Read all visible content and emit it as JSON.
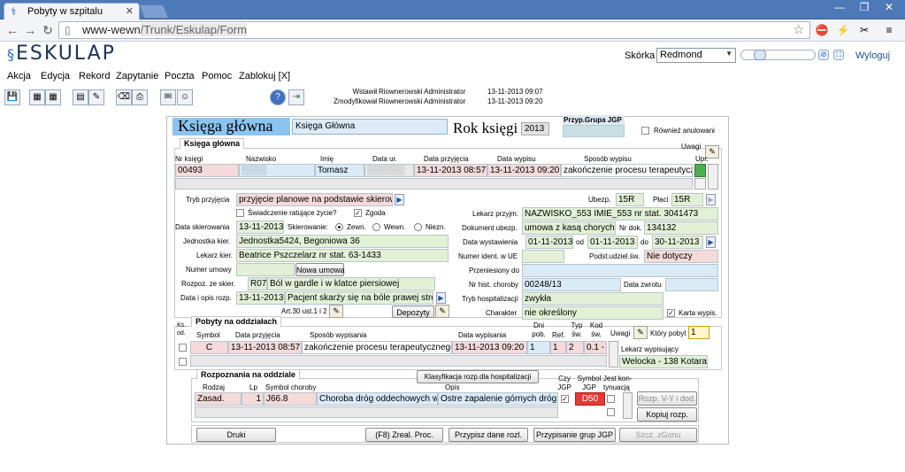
{
  "browser": {
    "tab_title": "Pobyty w szpitalu",
    "url_host": "www-wewn",
    "url_path": "/Trunk/Eskulap/Form",
    "icons": [
      "page-icon",
      "star-icon",
      "stop-icon",
      "bolt-icon",
      "plugin-icon",
      "menu-icon"
    ]
  },
  "app": {
    "logo": "ESKULAP",
    "skin_label": "Skórka",
    "skin_value": "Redmond",
    "logout": "Wyloguj"
  },
  "menu": [
    "Akcja",
    "Edycja",
    "Rekord",
    "Zapytanie",
    "Poczta",
    "Pomoc",
    "Zablokuj [X]"
  ],
  "audit": {
    "created_label": "Wstawił",
    "created_user": "Riownerowski Administrator",
    "created_time": "13-11-2013 09:07",
    "modified_label": "Zmodyfikował",
    "modified_user": "Riownerowski Administrator",
    "modified_time": "13-11-2013 09:20"
  },
  "form": {
    "title": "Księga główna",
    "book_name": "Księga Główna",
    "year_label": "Rok księgi",
    "year": "2013",
    "group_label": "Przyp.Grupa JGP",
    "also_cancelled": "Również anulowani",
    "section_main": "Księga główna",
    "cols": {
      "nr": "Nr księgi",
      "surname": "Nazwisko",
      "name": "Imię",
      "birth": "Data ur.",
      "admit": "Data przyjęcia",
      "discharge": "Data wypisu",
      "mode": "Sposób wypisu",
      "notes": "Uwagi",
      "upr": "Upr."
    },
    "row": {
      "nr": "00493",
      "name": "Tomasz",
      "admit": "13-11-2013 08:57",
      "discharge": "13-11-2013 09:20",
      "mode": "zakończenie procesu terapeutycz"
    },
    "admission_mode_label": "Tryb przyjęcia",
    "admission_mode": "przyjęcie planowe na podstawie skierow:",
    "ubezp_label": "Ubezp.",
    "ubezp": "15R",
    "payer_label": "Płaci",
    "payer": "15R",
    "rescue_label": "Świadczenie ratujące życie?",
    "consent_label": "Zgoda",
    "ref_date_label": "Data skierowania",
    "ref_date": "13-11-2013",
    "ref_label": "Skierowanie:",
    "ref_ext": "Zewn.",
    "ref_int": "Wewn.",
    "ref_unk": "Niezn.",
    "unit_label": "Jednostka kier.",
    "unit": "Jednostka5424, Begoniowa 36",
    "doctor_ref_label": "Lekarz kier.",
    "doctor_ref": "Beatrice Pszczelarz nr stat. 63-1433",
    "contract_label": "Numer umowy",
    "new_contract": "Nowa umowa",
    "diag_ref_label": "Rozpoz. ze skier.",
    "diag_ref_code": "R07",
    "diag_ref_desc": "Ból w gardle i w klatce piersiowej",
    "date_desc_label": "Data i opis rozp.",
    "date_desc_date": "13-11-2013",
    "date_desc": "Pacjent skarży się na bóle prawej stro",
    "art_label": "Art.30 ust.1 i 2",
    "deposits": "Depozyty",
    "doctor_admit_label": "Lekarz przyjm.",
    "doctor_admit": "NAZWISKO_553 IMIE_553 nr stat. 3041473",
    "insurance_doc_label": "Dokument ubezp.",
    "insurance_doc": "umowa z kasą chorych",
    "doc_no_label": "Nr dok.",
    "doc_no": "134132",
    "issue_date_label": "Data wystawienia",
    "issue_date": "01-11-2013",
    "from_label": "od",
    "from": "01-11-2013",
    "to_label": "do",
    "to": "30-11-2013",
    "ue_label": "Numer ident. w UE",
    "basis_label": "Podst.udziel.św.",
    "basis": "Nie dotyczy",
    "transferred_label": "Przeniesiony do",
    "hist_no_label": "Nr hist. choroby",
    "hist_no": "00248/13",
    "return_date_label": "Data zwrotu",
    "hosp_mode_label": "Tryb hospitalizacji",
    "hosp_mode": "zwykła",
    "character_label": "Charakter",
    "character": "nie określony",
    "card_label": "Karta wypis."
  },
  "stays": {
    "legend": "Pobyty na oddziałach",
    "cols": {
      "ks": "Ks. od.",
      "symbol": "Symbol",
      "admit": "Data przyjęcia",
      "mode": "Sposób wypisania",
      "discharge": "Data wypisania",
      "days": "Dni pob.",
      "ref": "Ref.",
      "type": "Typ św.",
      "code": "Kod św.",
      "notes": "Uwagi",
      "which": "Który pobyt"
    },
    "row": {
      "symbol": "C",
      "admit": "13-11-2013 08:57",
      "mode": "zakończenie procesu terapeutycznego l",
      "discharge": "13-11-2013 09:20",
      "days": "1",
      "ref": "1",
      "type": "2",
      "code": "0.1 - l"
    },
    "which": "1",
    "discharging_doctor_label": "Lekarz wypisujący",
    "discharging_doctor": "Welocka - 138 Kotara"
  },
  "diagnoses": {
    "legend": "Rozpoznania na oddziale",
    "classify_btn": "Klasyfikacja rozp.dla hospitalizacji",
    "cols": {
      "kind": "Rodzaj",
      "lp": "Lp",
      "symbol": "Symbol choroby",
      "desc": "Opis",
      "is_jgp": "Czy JGP",
      "jgp_symbol": "Symbol JGP",
      "cont": "Jest kon- tynuacją"
    },
    "row": {
      "kind": "Zasad.",
      "lp": "1",
      "symbol": "J66.8",
      "name": "Choroba dróg oddechowych wy",
      "desc": "Ostre zapalenie górnych dróg o",
      "jgp": "D50"
    },
    "vy_btn": "Rozp. V-Y i dod.",
    "copy_btn": "Kopiuj rozp."
  },
  "footer": {
    "print": "Druki",
    "f8": "(F8) Zreal. Proc.",
    "assign": "Przypisz dane rozl.",
    "groups": "Przypisanie grup JGP",
    "group_btn": "Szcz. zGonu"
  },
  "colors": {
    "chrome": "#4d79b8",
    "title_bg": "#8ac4f0",
    "field_green": "#e2f1d6",
    "field_pink": "#f5dada",
    "field_blue": "#d9ebf7",
    "jgp_red": "#e53935"
  }
}
